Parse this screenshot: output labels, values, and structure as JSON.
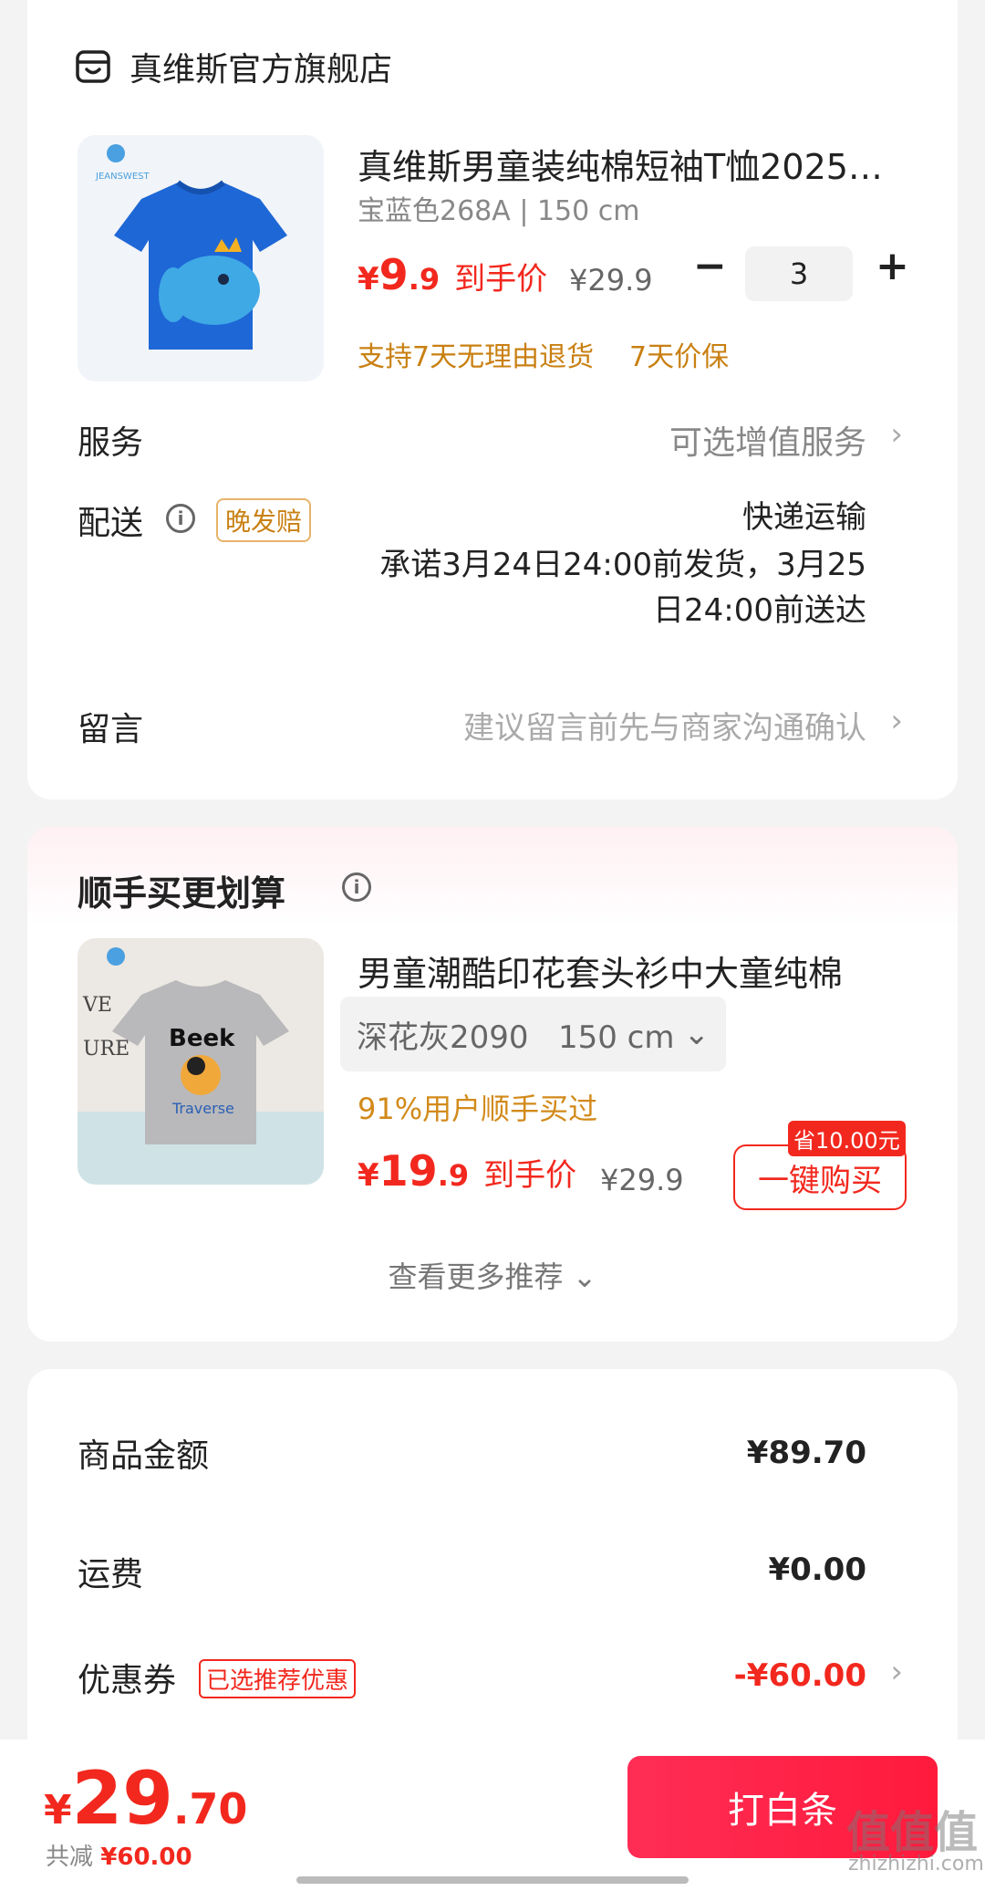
{
  "store": {
    "name": "真维斯官方旗舰店",
    "product": {
      "title": "真维斯男童装纯棉短袖T恤2025…",
      "spec": "宝蓝色268A | 150 cm",
      "price_currency": "¥",
      "price_int": "9",
      "price_dec": ".9",
      "price_label": "到手价",
      "original_price": "¥29.9",
      "quantity": "3",
      "minus": "−",
      "plus": "+",
      "guarantee_1": "支持7天无理由退货",
      "guarantee_2": "7天价保"
    },
    "service": {
      "label": "服务",
      "value": "可选增值服务",
      "chevron": "›"
    },
    "delivery": {
      "label": "配送",
      "info": "i",
      "badge": "晚发赔",
      "method": "快递运输",
      "promise_line1": "承诺3月24日24:00前发货，3月25",
      "promise_line2": "日24:00前送达"
    },
    "message": {
      "label": "留言",
      "placeholder": "建议留言前先与商家沟通确认",
      "chevron": "›"
    }
  },
  "recommendation": {
    "title": "顺手买更划算",
    "info": "i",
    "product": {
      "title": "男童潮酷印花套头衫中大童纯棉",
      "variant": "深花灰2090   150 cm",
      "variant_chevron": "⌄",
      "bought": "91%用户顺手买过",
      "price_currency": "¥",
      "price_int": "19",
      "price_dec": ".9",
      "price_label": "到手价",
      "original_price": "¥29.9",
      "save_tag": "省10.00元",
      "buy_label": "一键购买"
    },
    "more": "查看更多推荐 ⌄"
  },
  "summary": {
    "goods_label": "商品金额",
    "goods_value": "¥89.70",
    "shipping_label": "运费",
    "shipping_value": "¥0.00",
    "coupon_label": "优惠券",
    "coupon_badge": "已选推荐优惠",
    "coupon_value": "-¥60.00",
    "chevron": "›"
  },
  "bottom": {
    "currency": "¥",
    "total_int": "29",
    "total_dec": ".70",
    "saved_label": "共减",
    "saved_value": "¥60.00",
    "pay_label": "打白条",
    "watermark": "值值值",
    "watermark_sub": "zhizhizhi.com"
  },
  "colors": {
    "accent": "#f2281e",
    "guarantee": "#c98012",
    "pay_button": "#ff1a3c"
  }
}
